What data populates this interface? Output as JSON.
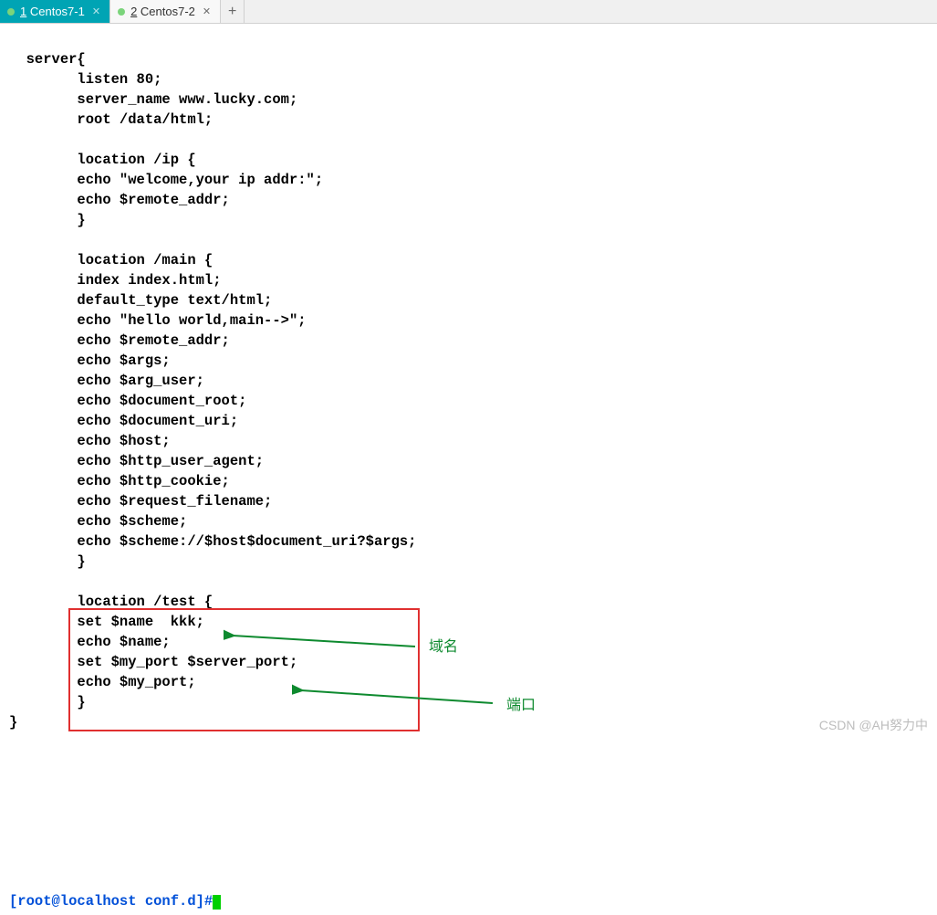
{
  "tabs": [
    {
      "num": "1",
      "label": "Centos7-1",
      "active": true
    },
    {
      "num": "2",
      "label": "Centos7-2",
      "active": false
    }
  ],
  "code": "server{\n        listen 80;\n        server_name www.lucky.com;\n        root /data/html;\n\n        location /ip {\n        echo \"welcome,your ip addr:\";\n        echo $remote_addr;\n        }\n\n        location /main {\n        index index.html;\n        default_type text/html;\n        echo \"hello world,main-->\";\n        echo $remote_addr;\n        echo $args;\n        echo $arg_user;\n        echo $document_root;\n        echo $document_uri;\n        echo $host;\n        echo $http_user_agent;\n        echo $http_cookie;\n        echo $request_filename;\n        echo $scheme;\n        echo $scheme://$host$document_uri?$args;\n        }\n\n        location /test {\n        set $name  kkk;\n        echo $name;\n        set $my_port $server_port;\n        echo $my_port;\n        }\n}",
  "prompt": "[root@localhost conf.d]#",
  "annotations": {
    "domain": "域名",
    "port": "端口"
  },
  "watermark": "CSDN @AH努力中"
}
